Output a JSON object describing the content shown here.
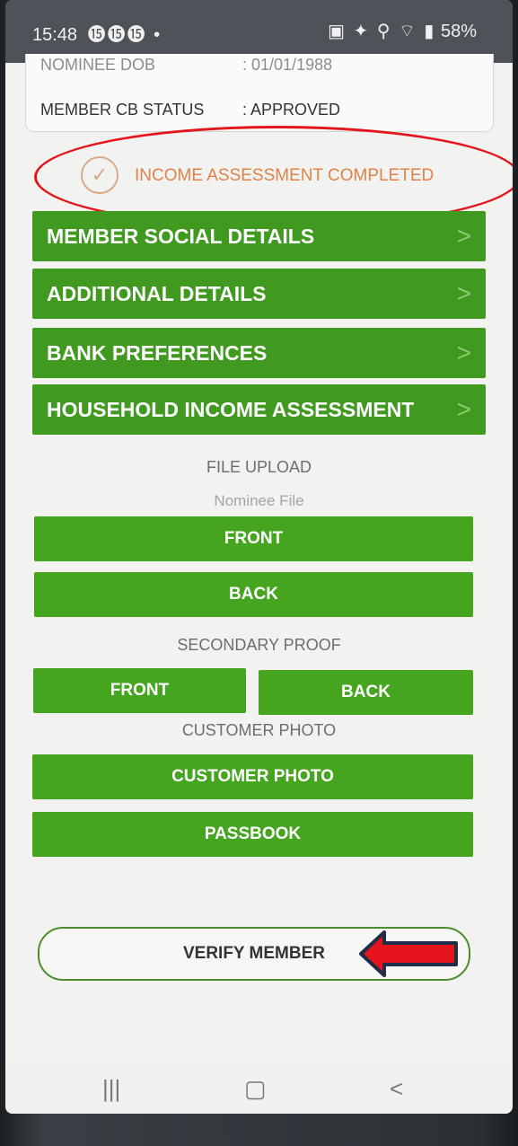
{
  "status_bar": {
    "time": "15:48",
    "left_icons": "⓯⓯⓯ •",
    "right_text": "58%",
    "right_icons": "▣ ✦ ⚲ ⌔ ▮"
  },
  "member_details": {
    "nominee_dob_label": "NOMINEE DOB",
    "nominee_dob_value": ": 01/01/1988",
    "cb_status_label": "MEMBER CB STATUS",
    "cb_status_value": ": APPROVED"
  },
  "income_status": {
    "check_glyph": "✓",
    "text": "INCOME ASSESSMENT COMPLETED"
  },
  "sections": [
    {
      "label": "MEMBER SOCIAL DETAILS",
      "chevron": ">"
    },
    {
      "label": "ADDITIONAL DETAILS",
      "chevron": ">"
    },
    {
      "label": "BANK PREFERENCES",
      "chevron": ">"
    },
    {
      "label": "HOUSEHOLD INCOME ASSESSMENT",
      "chevron": ">"
    }
  ],
  "file_upload": {
    "title": "FILE UPLOAD",
    "nominee_file_label": "Nominee File",
    "front": "FRONT",
    "back": "BACK",
    "secondary_proof_label": "SECONDARY PROOF",
    "secondary_front": "FRONT",
    "secondary_back": "BACK",
    "customer_photo_label": "CUSTOMER PHOTO",
    "customer_photo_button": "CUSTOMER PHOTO",
    "passbook_button": "PASSBOOK"
  },
  "verify_button": "VERIFY MEMBER",
  "navbar": {
    "recents": "|||",
    "home": "▢",
    "back": "<"
  },
  "colors": {
    "green": "#45a51f",
    "annotation_red": "#e5161b",
    "arrow_outline": "#1f2d4a",
    "income_text": "#e0824a"
  }
}
